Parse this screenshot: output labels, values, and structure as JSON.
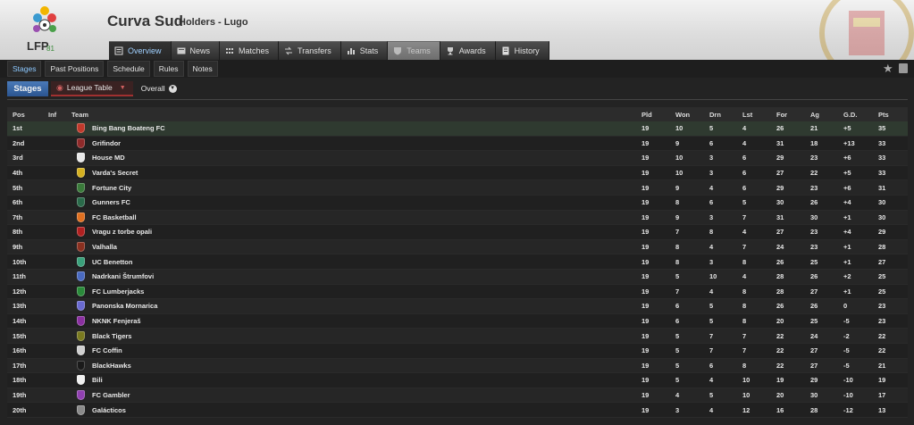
{
  "header": {
    "title": "Curva Sud",
    "subtitle": "Holders - Lugo",
    "logo_text": "LFP",
    "logo_sub": "81"
  },
  "tabs": [
    {
      "label": "Overview",
      "icon": "overview-icon",
      "state": "active"
    },
    {
      "label": "News",
      "icon": "news-icon",
      "state": "normal"
    },
    {
      "label": "Matches",
      "icon": "matches-icon",
      "state": "normal"
    },
    {
      "label": "Transfers",
      "icon": "transfers-icon",
      "state": "normal"
    },
    {
      "label": "Stats",
      "icon": "stats-icon",
      "state": "normal"
    },
    {
      "label": "Teams",
      "icon": "shield-icon",
      "state": "dim"
    },
    {
      "label": "Awards",
      "icon": "trophy-icon",
      "state": "normal"
    },
    {
      "label": "History",
      "icon": "history-icon",
      "state": "normal"
    }
  ],
  "subnav": [
    "Stages",
    "Past Positions",
    "Schedule",
    "Rules",
    "Notes"
  ],
  "toolbar": {
    "stages_label": "Stages",
    "league_label": "League Table",
    "overall_label": "Overall"
  },
  "table": {
    "headers": [
      "Pos",
      "Inf",
      "Team",
      "Pld",
      "Won",
      "Drn",
      "Lst",
      "For",
      "Ag",
      "G.D.",
      "Pts"
    ],
    "rows": [
      {
        "pos": "1st",
        "team": "Bing Bang Boateng FC",
        "pld": "19",
        "won": "10",
        "drn": "5",
        "lst": "4",
        "for": "26",
        "ag": "21",
        "gd": "+5",
        "pts": "35",
        "color": "#c0392b"
      },
      {
        "pos": "2nd",
        "team": "Grifindor",
        "pld": "19",
        "won": "9",
        "drn": "6",
        "lst": "4",
        "for": "31",
        "ag": "18",
        "gd": "+13",
        "pts": "33",
        "color": "#8e2a2a"
      },
      {
        "pos": "3rd",
        "team": "House MD",
        "pld": "19",
        "won": "10",
        "drn": "3",
        "lst": "6",
        "for": "29",
        "ag": "23",
        "gd": "+6",
        "pts": "33",
        "color": "#e8e8e8"
      },
      {
        "pos": "4th",
        "team": "Varda's Secret",
        "pld": "19",
        "won": "10",
        "drn": "3",
        "lst": "6",
        "for": "27",
        "ag": "22",
        "gd": "+5",
        "pts": "33",
        "color": "#d4b020"
      },
      {
        "pos": "5th",
        "team": "Fortune City",
        "pld": "19",
        "won": "9",
        "drn": "4",
        "lst": "6",
        "for": "29",
        "ag": "23",
        "gd": "+6",
        "pts": "31",
        "color": "#3a7a3a"
      },
      {
        "pos": "6th",
        "team": "Gunners FC",
        "pld": "19",
        "won": "8",
        "drn": "6",
        "lst": "5",
        "for": "30",
        "ag": "26",
        "gd": "+4",
        "pts": "30",
        "color": "#2a6a4a"
      },
      {
        "pos": "7th",
        "team": "FC Basketball",
        "pld": "19",
        "won": "9",
        "drn": "3",
        "lst": "7",
        "for": "31",
        "ag": "30",
        "gd": "+1",
        "pts": "30",
        "color": "#e07020"
      },
      {
        "pos": "8th",
        "team": "Vragu z torbe opali",
        "pld": "19",
        "won": "7",
        "drn": "8",
        "lst": "4",
        "for": "27",
        "ag": "23",
        "gd": "+4",
        "pts": "29",
        "color": "#b02020"
      },
      {
        "pos": "9th",
        "team": "Valhalla",
        "pld": "19",
        "won": "8",
        "drn": "4",
        "lst": "7",
        "for": "24",
        "ag": "23",
        "gd": "+1",
        "pts": "28",
        "color": "#8a3020"
      },
      {
        "pos": "10th",
        "team": "UC Benetton",
        "pld": "19",
        "won": "8",
        "drn": "3",
        "lst": "8",
        "for": "26",
        "ag": "25",
        "gd": "+1",
        "pts": "27",
        "color": "#3aa07a"
      },
      {
        "pos": "11th",
        "team": "Nadrkani Štrumfovi",
        "pld": "19",
        "won": "5",
        "drn": "10",
        "lst": "4",
        "for": "28",
        "ag": "26",
        "gd": "+2",
        "pts": "25",
        "color": "#4a6ac0"
      },
      {
        "pos": "12th",
        "team": "FC Lumberjacks",
        "pld": "19",
        "won": "7",
        "drn": "4",
        "lst": "8",
        "for": "28",
        "ag": "27",
        "gd": "+1",
        "pts": "25",
        "color": "#2a8a3a"
      },
      {
        "pos": "13th",
        "team": "Panonska Mornarica",
        "pld": "19",
        "won": "6",
        "drn": "5",
        "lst": "8",
        "for": "26",
        "ag": "26",
        "gd": "0",
        "pts": "23",
        "color": "#6a6ad0"
      },
      {
        "pos": "14th",
        "team": "NKNK Fenjeraš",
        "pld": "19",
        "won": "6",
        "drn": "5",
        "lst": "8",
        "for": "20",
        "ag": "25",
        "gd": "-5",
        "pts": "23",
        "color": "#8a30a0"
      },
      {
        "pos": "15th",
        "team": "Black Tigers",
        "pld": "19",
        "won": "5",
        "drn": "7",
        "lst": "7",
        "for": "22",
        "ag": "24",
        "gd": "-2",
        "pts": "22",
        "color": "#7a7a20"
      },
      {
        "pos": "16th",
        "team": "FC Coffin",
        "pld": "19",
        "won": "5",
        "drn": "7",
        "lst": "7",
        "for": "22",
        "ag": "27",
        "gd": "-5",
        "pts": "22",
        "color": "#cfcfcf"
      },
      {
        "pos": "17th",
        "team": "BlackHawks",
        "pld": "19",
        "won": "5",
        "drn": "6",
        "lst": "8",
        "for": "22",
        "ag": "27",
        "gd": "-5",
        "pts": "21",
        "color": "#1a1a1a"
      },
      {
        "pos": "18th",
        "team": "Bili",
        "pld": "19",
        "won": "5",
        "drn": "4",
        "lst": "10",
        "for": "19",
        "ag": "29",
        "gd": "-10",
        "pts": "19",
        "color": "#f0f0f0"
      },
      {
        "pos": "19th",
        "team": "FC Gambler",
        "pld": "19",
        "won": "4",
        "drn": "5",
        "lst": "10",
        "for": "20",
        "ag": "30",
        "gd": "-10",
        "pts": "17",
        "color": "#9040b0"
      },
      {
        "pos": "20th",
        "team": "Galácticos",
        "pld": "19",
        "won": "3",
        "drn": "4",
        "lst": "12",
        "for": "16",
        "ag": "28",
        "gd": "-12",
        "pts": "13",
        "color": "#8a8a8a"
      }
    ]
  },
  "colors": {
    "accent_blue": "#2b5590",
    "leader_row": "#2f3a30",
    "league_table_red": "#a03030"
  }
}
